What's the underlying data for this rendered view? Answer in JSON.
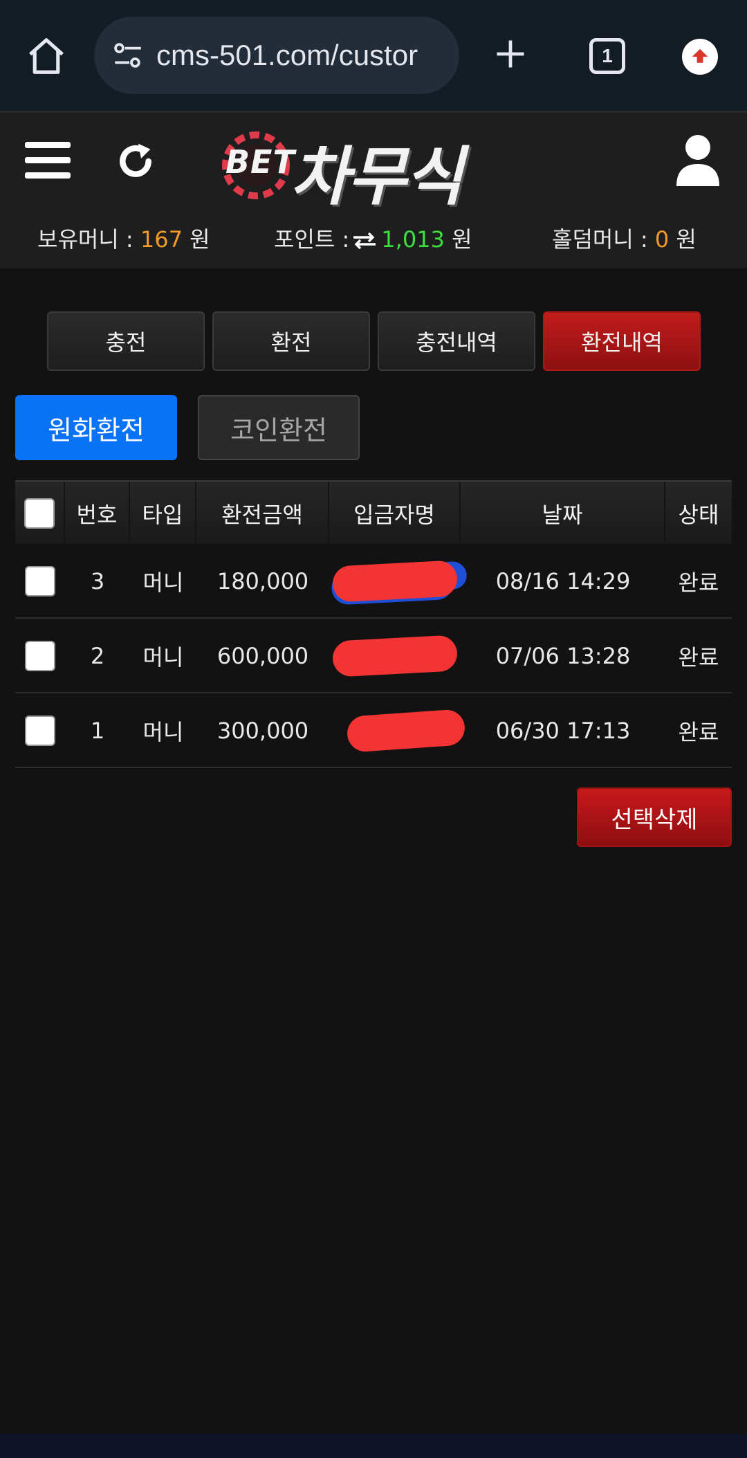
{
  "browser": {
    "url": "cms-501.com/custor",
    "tab_count": "1"
  },
  "header": {
    "logo_prefix": "BET",
    "logo_brand": "차무식"
  },
  "balance": {
    "money_label": "보유머니 :",
    "money_value": "167",
    "money_unit": "원",
    "point_label": "포인트 :",
    "point_value": "1,013",
    "point_unit": "원",
    "holdem_label": "홀덤머니 :",
    "holdem_value": "0",
    "holdem_unit": "원"
  },
  "main_tabs": [
    {
      "label": "충전",
      "active": false
    },
    {
      "label": "환전",
      "active": false
    },
    {
      "label": "충전내역",
      "active": false
    },
    {
      "label": "환전내역",
      "active": true
    }
  ],
  "sub_tabs": [
    {
      "label": "원화환전",
      "active": true
    },
    {
      "label": "코인환전",
      "active": false
    }
  ],
  "table": {
    "columns": [
      "번호",
      "타입",
      "환전금액",
      "입금자명",
      "날짜",
      "상태"
    ],
    "rows": [
      {
        "no": "3",
        "type": "머니",
        "amount": "180,000",
        "name": "",
        "date": "08/16 14:29",
        "status": "완료"
      },
      {
        "no": "2",
        "type": "머니",
        "amount": "600,000",
        "name": "",
        "date": "07/06 13:28",
        "status": "완료"
      },
      {
        "no": "1",
        "type": "머니",
        "amount": "300,000",
        "name": "",
        "date": "06/30 17:13",
        "status": "완료"
      }
    ]
  },
  "actions": {
    "delete_selected": "선택삭제"
  },
  "colors": {
    "accent_red": "#c21c1c",
    "accent_blue": "#0a72f4",
    "money_orange": "#f59a27",
    "point_green": "#3ce040"
  },
  "icons": [
    "home-icon",
    "tune-icon",
    "plus-icon",
    "tabs-icon",
    "update-icon",
    "menu-icon",
    "refresh-icon",
    "user-icon",
    "swap-icon"
  ]
}
